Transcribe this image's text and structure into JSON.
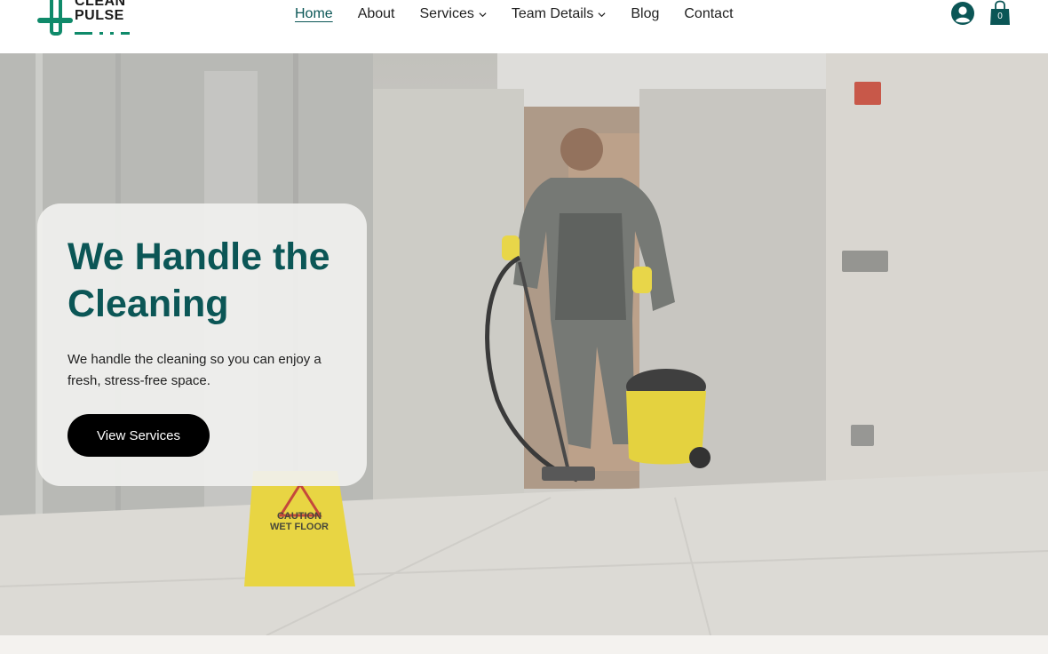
{
  "brand": {
    "line1": "CLEAN",
    "line2": "PULSE",
    "accent_color": "#0b5656",
    "logo_green": "#0f8a6a"
  },
  "nav": {
    "items": [
      {
        "label": "Home",
        "active": true,
        "has_dropdown": false
      },
      {
        "label": "About",
        "active": false,
        "has_dropdown": false
      },
      {
        "label": "Services",
        "active": false,
        "has_dropdown": true
      },
      {
        "label": "Team Details",
        "active": false,
        "has_dropdown": true
      },
      {
        "label": "Blog",
        "active": false,
        "has_dropdown": false
      },
      {
        "label": "Contact",
        "active": false,
        "has_dropdown": false
      }
    ]
  },
  "header_actions": {
    "user_icon": "user-circle-icon",
    "cart_icon": "shopping-bag-icon",
    "cart_count": "0"
  },
  "hero": {
    "title": "We Handle the Cleaning",
    "description": "We handle the cleaning so you can enjoy a fresh, stress-free space.",
    "cta_label": "View Services",
    "sign_line1": "CAUTION",
    "sign_line2": "WET FLOOR"
  }
}
